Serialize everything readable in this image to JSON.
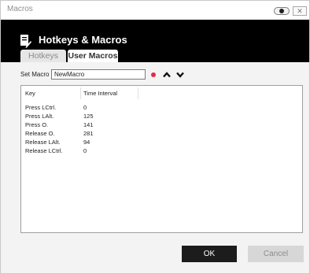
{
  "window": {
    "title": "Macros",
    "close_glyph": "✕"
  },
  "header": {
    "title": "Hotkeys & Macros",
    "icon": "document-pen-icon"
  },
  "tabs": [
    {
      "label": "Hotkeys",
      "active": false
    },
    {
      "label": "User Macros",
      "active": true
    }
  ],
  "macro": {
    "set_label": "Set Macro",
    "name_value": "NewMacro",
    "record_color": "#e52a4b"
  },
  "table": {
    "columns": [
      "Key",
      "Time Interval"
    ],
    "rows": [
      {
        "key": "Press LCtrl.",
        "time": "0"
      },
      {
        "key": "Press LAlt.",
        "time": "125"
      },
      {
        "key": "Press O.",
        "time": "141"
      },
      {
        "key": "Release O.",
        "time": "281"
      },
      {
        "key": "Release LAlt.",
        "time": "94"
      },
      {
        "key": "Release LCtrl.",
        "time": "0"
      }
    ]
  },
  "buttons": {
    "ok": "OK",
    "cancel": "Cancel"
  },
  "colors": {
    "header_bg": "#000000",
    "ok_bg": "#1c1c1c",
    "cancel_bg": "#d7d7d7"
  }
}
